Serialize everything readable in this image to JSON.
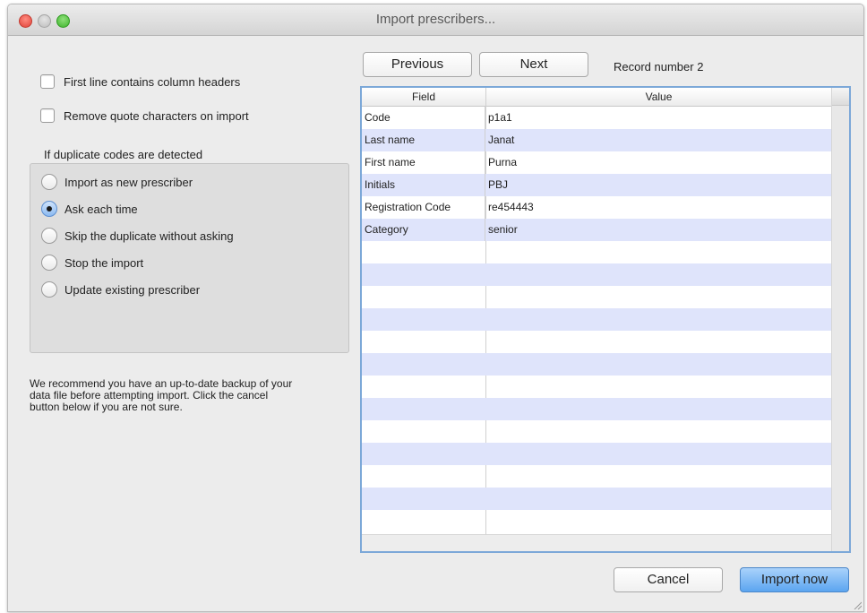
{
  "window": {
    "title": "Import prescribers..."
  },
  "options": {
    "first_line_headers": {
      "label": "First line contains column headers",
      "checked": false
    },
    "remove_quotes": {
      "label": "Remove quote characters on import",
      "checked": false
    }
  },
  "duplicates": {
    "label": "If duplicate codes are detected",
    "selected": 1,
    "options": [
      {
        "label": "Import as new prescriber"
      },
      {
        "label": "Ask each time"
      },
      {
        "label": "Skip the duplicate without asking"
      },
      {
        "label": "Stop the import"
      },
      {
        "label": "Update existing prescriber"
      }
    ]
  },
  "note": "We recommend you have an up-to-date backup of your data file before attempting import. Click the cancel button below if you are not sure.",
  "nav": {
    "previous_label": "Previous",
    "next_label": "Next",
    "record_text": "Record number 2"
  },
  "table": {
    "headers": {
      "field": "Field",
      "value": "Value"
    },
    "rows": [
      {
        "field": "Code",
        "value": "p1a1"
      },
      {
        "field": "Last name",
        "value": "Janat"
      },
      {
        "field": "First name",
        "value": "Purna"
      },
      {
        "field": "Initials",
        "value": "PBJ"
      },
      {
        "field": "Registration Code",
        "value": "re454443"
      },
      {
        "field": "Category",
        "value": "senior"
      }
    ],
    "alt_row_color": "#dfe4fb"
  },
  "footer": {
    "cancel_label": "Cancel",
    "import_label": "Import now"
  },
  "colors": {
    "accent": "#5ba5f0",
    "table_border": "#7ca8d8"
  }
}
